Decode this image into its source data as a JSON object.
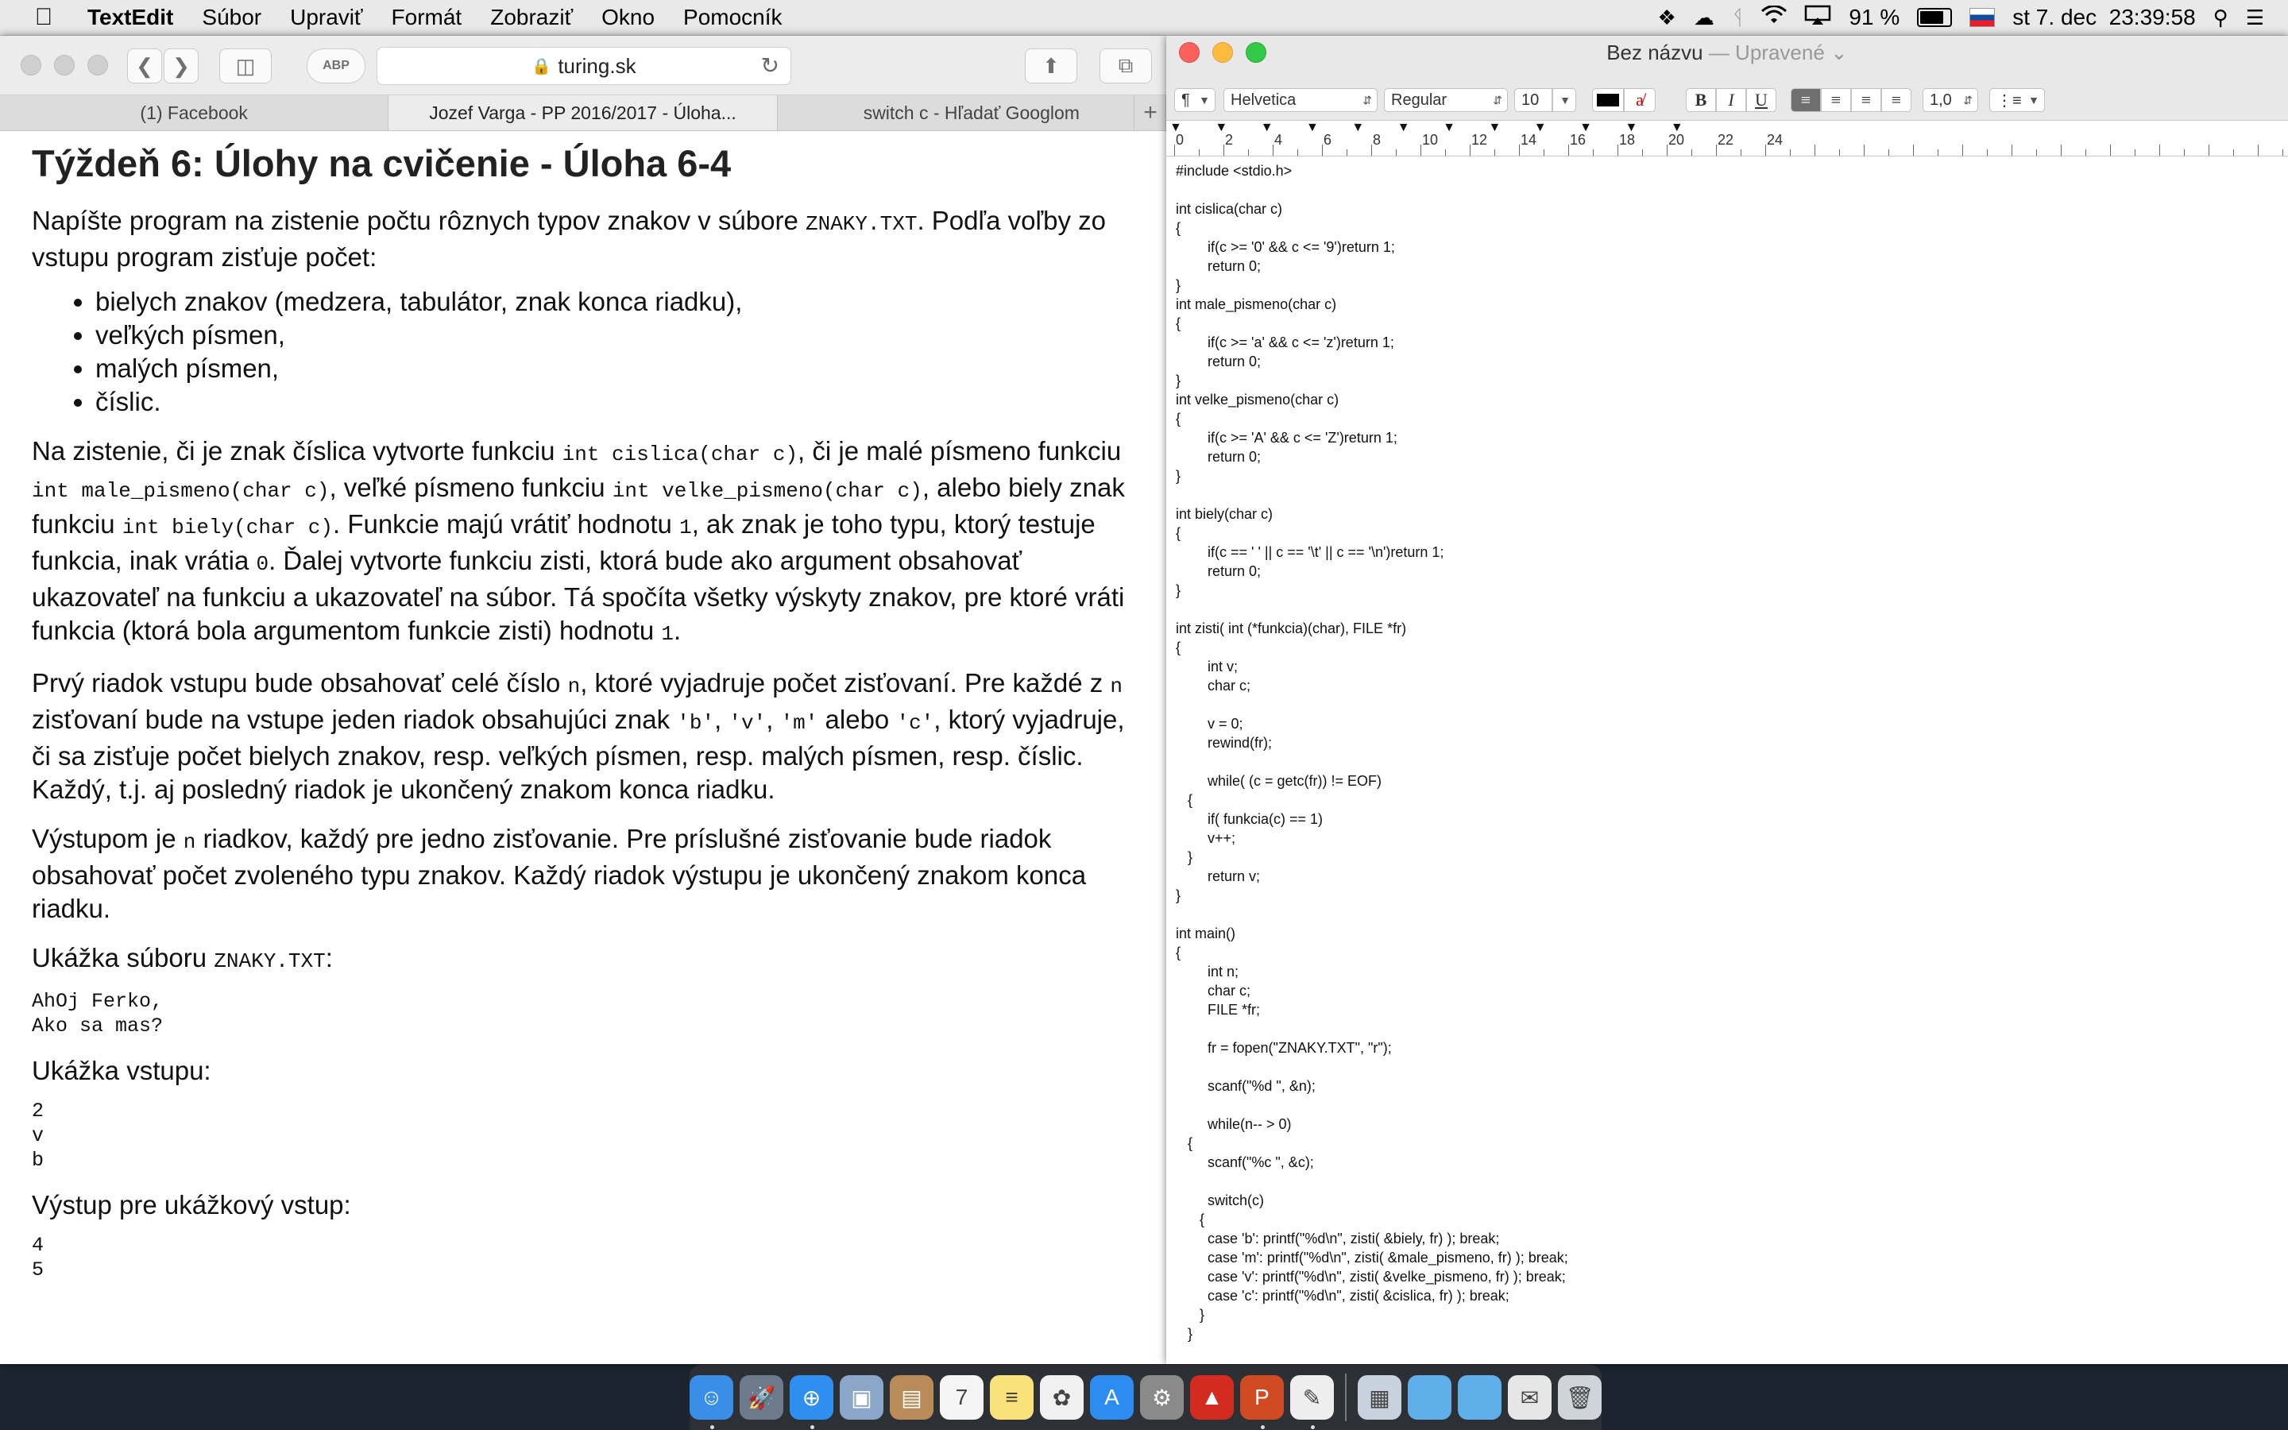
{
  "menubar": {
    "apple": "",
    "app_name": "TextEdit",
    "menus": [
      "Súbor",
      "Upraviť",
      "Formát",
      "Zobraziť",
      "Okno",
      "Pomocník"
    ],
    "battery": "91 %",
    "battery_level": 0.91,
    "clock": "st 7. dec  23:39:58",
    "icons": [
      "dropbox-icon",
      "cloud-icon",
      "bluetooth-icon",
      "wifi-icon",
      "airplay-icon",
      "battery-icon",
      "flag-sk-icon",
      "spotlight-icon",
      "notification-center-icon"
    ]
  },
  "safari": {
    "url": "turing.sk",
    "tabs": [
      {
        "label": "(1) Facebook",
        "active": false
      },
      {
        "label": "Jozef Varga - PP 2016/2017 - Úloha...",
        "active": true
      },
      {
        "label": "switch c - Hľadať Googlom",
        "active": false
      }
    ],
    "page": {
      "title": "Týždeň 6: Úlohy na cvičenie - Úloha 6-4",
      "p1_a": "Napíšte program na zistenie počtu rôznych typov znakov v súbore ",
      "p1_code": "ZNAKY.TXT",
      "p1_b": ". Podľa voľby zo vstupu program zisťuje počet:",
      "bullets": [
        "bielych znakov (medzera, tabulátor, znak konca riadku),",
        "veľkých písmen,",
        "malých písmen,",
        "číslic."
      ],
      "p2": [
        {
          "t": "Na zistenie, či je znak číslica vytvorte funkciu "
        },
        {
          "c": "int cislica(char c)"
        },
        {
          "t": ", či je malé písmeno funkciu "
        },
        {
          "c": "int male_pismeno(char c)"
        },
        {
          "t": ", veľké písmeno funkciu "
        },
        {
          "c": "int velke_pismeno(char c)"
        },
        {
          "t": ", alebo biely znak funkciu "
        },
        {
          "c": "int biely(char c)"
        },
        {
          "t": ". Funkcie majú vrátiť hodnotu "
        },
        {
          "c": "1"
        },
        {
          "t": ", ak znak je toho typu, ktorý testuje funkcia, inak vrátia "
        },
        {
          "c": "0"
        },
        {
          "t": ". Ďalej vytvorte funkciu zisti, ktorá bude ako argument obsahovať ukazovateľ na funkciu a ukazovateľ na súbor. Tá spočíta všetky výskyty znakov, pre ktoré vráti funkcia (ktorá bola argumentom funkcie zisti) hodnotu "
        },
        {
          "c": "1"
        },
        {
          "t": "."
        }
      ],
      "p3": [
        {
          "t": "Prvý riadok vstupu bude obsahovať celé číslo "
        },
        {
          "c": "n"
        },
        {
          "t": ", ktoré vyjadruje počet zisťovaní. Pre každé z "
        },
        {
          "c": "n"
        },
        {
          "t": " zisťovaní bude na vstupe jeden riadok obsahujúci znak "
        },
        {
          "c": "'b'"
        },
        {
          "t": ", "
        },
        {
          "c": "'v'"
        },
        {
          "t": ", "
        },
        {
          "c": "'m'"
        },
        {
          "t": " alebo "
        },
        {
          "c": "'c'"
        },
        {
          "t": ", ktorý vyjadruje, či sa zisťuje počet bielych znakov, resp. veľkých písmen, resp. malých písmen, resp. číslic. Každý, t.j. aj posledný riadok je ukončený znakom konca riadku."
        }
      ],
      "p4": [
        {
          "t": "Výstupom je "
        },
        {
          "c": "n"
        },
        {
          "t": " riadkov, každý pre jedno zisťovanie. Pre príslušné zisťovanie bude riadok obsahovať počet zvoleného typu znakov. Každý riadok výstupu je ukončený znakom konca riadku."
        }
      ],
      "sample_file_label": "Ukážka súboru ",
      "sample_file_code": "ZNAKY.TXT",
      "sample_file_colon": ":",
      "sample_file": "AhOj Ferko,\nAko sa mas?",
      "sample_input_label": "Ukážka vstupu:",
      "sample_input": "2\nv\nb",
      "sample_output_label": "Výstup pre ukážkový vstup:",
      "sample_output": "4\n5"
    }
  },
  "textedit": {
    "title": "Bez názvu",
    "title_sep": " — ",
    "status": "Upravené",
    "format": {
      "paragraph": "¶",
      "font": "Helvetica",
      "style": "Regular",
      "size": "10",
      "spacing": "1,0",
      "bold": "B",
      "italic": "I",
      "underline": "U"
    },
    "ruler_numbers": [
      "0",
      "2",
      "4",
      "6",
      "8",
      "10",
      "12",
      "14",
      "16",
      "18",
      "20",
      "22",
      "24"
    ],
    "code_lines": [
      "#include <stdio.h>",
      "",
      "int cislica(char c)",
      "{",
      "        if(c >= '0' && c <= '9')return 1;",
      "        return 0;",
      "}",
      "int male_pismeno(char c)",
      "{",
      "        if(c >= 'a' && c <= 'z')return 1;",
      "        return 0;",
      "}",
      "int velke_pismeno(char c)",
      "{",
      "        if(c >= 'A' && c <= 'Z')return 1;",
      "        return 0;",
      "}",
      "",
      "int biely(char c)",
      "{",
      "        if(c == ' ' || c == '\\t' || c == '\\n')return 1;",
      "        return 0;",
      "}",
      "",
      "int zisti( int (*funkcia)(char), FILE *fr)",
      "{",
      "        int v;",
      "        char c;",
      "",
      "        v = 0;",
      "        rewind(fr);",
      "",
      "        while( (c = getc(fr)) != EOF)",
      "   {",
      "        if( funkcia(c) == 1)",
      "        v++;",
      "   }",
      "        return v;",
      "}",
      "",
      "int main()",
      "{",
      "        int n;",
      "        char c;",
      "        FILE *fr;",
      "",
      "        fr = fopen(\"ZNAKY.TXT\", \"r\");",
      "",
      "        scanf(\"%d \", &n);",
      "",
      "        while(n-- > 0)",
      "   {",
      "        scanf(\"%c \", &c);",
      "",
      "        switch(c)",
      "      {",
      "        case 'b': printf(\"%d\\n\", zisti( &biely, fr) ); break;",
      "        case 'm': printf(\"%d\\n\", zisti( &male_pismeno, fr) ); break;",
      "        case 'v': printf(\"%d\\n\", zisti( &velke_pismeno, fr) ); break;",
      "        case 'c': printf(\"%d\\n\", zisti( &cislica, fr) ); break;",
      "      }",
      "   }"
    ]
  },
  "dock": {
    "apps": [
      {
        "name": "finder",
        "color": "#3a8ee6",
        "glyph": "☺",
        "running": true
      },
      {
        "name": "launchpad",
        "color": "#6d7a8c",
        "glyph": "🚀",
        "running": false
      },
      {
        "name": "safari",
        "color": "#2f8ff0",
        "glyph": "⊕",
        "running": true
      },
      {
        "name": "preview",
        "color": "#8aa6c8",
        "glyph": "▣",
        "running": false
      },
      {
        "name": "contacts",
        "color": "#b98b58",
        "glyph": "▤",
        "running": false
      },
      {
        "name": "calendar",
        "color": "#f5f5f5",
        "glyph": "7",
        "running": false
      },
      {
        "name": "notes",
        "color": "#f9e27a",
        "glyph": "≡",
        "running": false
      },
      {
        "name": "photos",
        "color": "#f0f0f0",
        "glyph": "✿",
        "running": false
      },
      {
        "name": "app-store",
        "color": "#2d8cf0",
        "glyph": "A",
        "running": false
      },
      {
        "name": "system-preferences",
        "color": "#8a8a8a",
        "glyph": "⚙",
        "running": false
      },
      {
        "name": "acrobat",
        "color": "#d32b20",
        "glyph": "▲",
        "running": false
      },
      {
        "name": "powerpoint",
        "color": "#d04a22",
        "glyph": "P",
        "running": true
      },
      {
        "name": "textedit",
        "color": "#eeeeee",
        "glyph": "✎",
        "running": true
      },
      {
        "name": "separator",
        "color": "",
        "glyph": "",
        "running": false
      },
      {
        "name": "downloads-stack",
        "color": "#c8d2de",
        "glyph": "▦",
        "running": false
      },
      {
        "name": "folder-1",
        "color": "#5fb0ea",
        "glyph": "",
        "running": false
      },
      {
        "name": "folder-2",
        "color": "#5fb0ea",
        "glyph": "",
        "running": false
      },
      {
        "name": "mail-stack",
        "color": "#e6e6e6",
        "glyph": "✉",
        "running": false
      },
      {
        "name": "trash",
        "color": "#cfd4d9",
        "glyph": "🗑",
        "running": false
      }
    ]
  }
}
